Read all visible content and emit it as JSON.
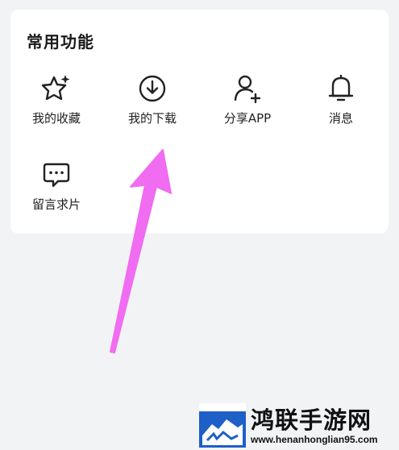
{
  "section": {
    "title": "常用功能"
  },
  "items": [
    {
      "label": "我的收藏",
      "icon": "star-sparkle-icon"
    },
    {
      "label": "我的下载",
      "icon": "download-icon"
    },
    {
      "label": "分享APP",
      "icon": "user-add-icon"
    },
    {
      "label": "消息",
      "icon": "bell-icon"
    },
    {
      "label": "留言求片",
      "icon": "chat-bubble-icon"
    }
  ],
  "annotation": {
    "color": "#f06cf0"
  },
  "watermark": {
    "name": "鸿联手游网",
    "url": "www.henanhonglian95.com",
    "logo_color": "#1e5fc8"
  }
}
